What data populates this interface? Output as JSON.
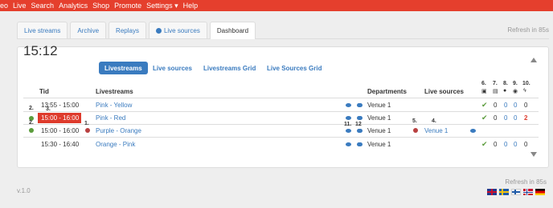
{
  "navbar": {
    "items": [
      "eo",
      "Live",
      "Search",
      "Analytics",
      "Shop",
      "Promote",
      "Settings ▾",
      "Help"
    ]
  },
  "tabs": {
    "items": [
      "Live streams",
      "Archive",
      "Replays",
      "Live sources",
      "Dashboard"
    ],
    "refresh": "Refresh in 85s"
  },
  "dashboard": {
    "time": "15:12",
    "pills": [
      "Livestreams",
      "Live sources",
      "Livestreams Grid",
      "Live Sources Grid"
    ]
  },
  "table": {
    "headers": {
      "tid": "Tid",
      "livestreams": "Livestreams",
      "departments": "Departments",
      "live_sources": "Live sources",
      "c6": "6.",
      "c7": "7.",
      "c8": "8.",
      "c9": "9.",
      "c10": "10."
    },
    "rows": [
      {
        "time": "13:55 - 15:00",
        "name": "Pink - Yellow",
        "department": "Venue 1",
        "source": "",
        "c7": "0",
        "c8": "0",
        "c9": "0",
        "c10": "0"
      },
      {
        "time": "15:00 - 16:00",
        "name": "Pink - Red",
        "department": "Venue 1",
        "source": "",
        "c7": "0",
        "c8": "0",
        "c9": "0",
        "c10": "2"
      },
      {
        "time": "15:00 - 16:00",
        "name": "Purple - Orange",
        "department": "Venue 1",
        "source": "Venue 1",
        "c7": "",
        "c8": "",
        "c9": "",
        "c10": ""
      },
      {
        "time": "15:30 - 16:40",
        "name": "Orange - Pink",
        "department": "Venue 1",
        "source": "",
        "c7": "0",
        "c8": "0",
        "c9": "0",
        "c10": "0"
      }
    ],
    "annotations": [
      "2.",
      "3.",
      "2.",
      "1.",
      "11.",
      "12",
      "5.",
      "4."
    ]
  },
  "footer": {
    "version": "v.1.0",
    "refresh": "Refresh in 85s"
  },
  "colors": {
    "navbar": "#e53f2d",
    "link": "#3a7bbf",
    "green": "#5b9c3c",
    "red": "#de3b2c"
  }
}
